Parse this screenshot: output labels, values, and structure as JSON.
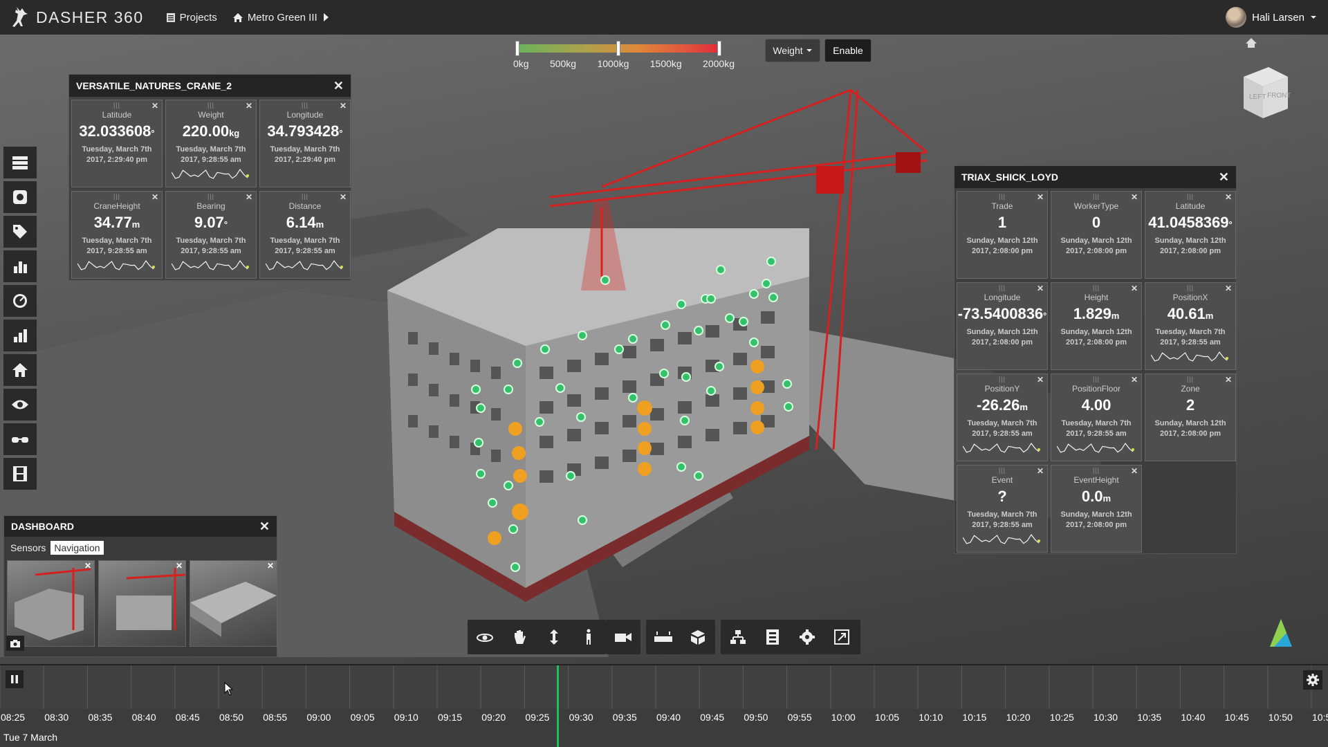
{
  "app": {
    "title": "DASHER 360"
  },
  "breadcrumb": {
    "projects": "Projects",
    "project": "Metro Green III"
  },
  "user": {
    "name": "Hali Larsen"
  },
  "scale": {
    "labels": [
      "0kg",
      "500kg",
      "1000kg",
      "1500kg",
      "2000kg"
    ],
    "weight_button": "Weight",
    "enable_button": "Enable"
  },
  "crane_panel": {
    "title": "VERSATILE_NATURES_CRANE_2",
    "tiles": [
      {
        "label": "Latitude",
        "value": "32.033608",
        "unit": "°",
        "date": "Tuesday, March 7th 2017, 2:29:40 pm",
        "spark": false
      },
      {
        "label": "Weight",
        "value": "220.00",
        "unit": "kg",
        "date": "Tuesday, March 7th 2017, 9:28:55 am",
        "spark": true
      },
      {
        "label": "Longitude",
        "value": "34.793428",
        "unit": "°",
        "date": "Tuesday, March 7th 2017, 2:29:40 pm",
        "spark": false
      },
      {
        "label": "CraneHeight",
        "value": "34.77",
        "unit": "m",
        "date": "Tuesday, March 7th 2017, 9:28:55 am",
        "spark": true
      },
      {
        "label": "Bearing",
        "value": "9.07",
        "unit": "°",
        "date": "Tuesday, March 7th 2017, 9:28:55 am",
        "spark": true
      },
      {
        "label": "Distance",
        "value": "6.14",
        "unit": "m",
        "date": "Tuesday, March 7th 2017, 9:28:55 am",
        "spark": true
      }
    ]
  },
  "worker_panel": {
    "title": "TRIAX_SHICK_LOYD",
    "tiles": [
      {
        "label": "Trade",
        "value": "1",
        "unit": "",
        "date": "Sunday, March 12th 2017, 2:08:00 pm",
        "spark": false
      },
      {
        "label": "WorkerType",
        "value": "0",
        "unit": "",
        "date": "Sunday, March 12th 2017, 2:08:00 pm",
        "spark": false
      },
      {
        "label": "Latitude",
        "value": "41.0458369",
        "unit": "°",
        "date": "Sunday, March 12th 2017, 2:08:00 pm",
        "spark": false
      },
      {
        "label": "Longitude",
        "value": "-73.5400836",
        "unit": "°",
        "date": "Sunday, March 12th 2017, 2:08:00 pm",
        "spark": false
      },
      {
        "label": "Height",
        "value": "1.829",
        "unit": "m",
        "date": "Sunday, March 12th 2017, 2:08:00 pm",
        "spark": false
      },
      {
        "label": "PositionX",
        "value": "40.61",
        "unit": "m",
        "date": "Tuesday, March 7th 2017, 9:28:55 am",
        "spark": true
      },
      {
        "label": "PositionY",
        "value": "-26.26",
        "unit": "m",
        "date": "Tuesday, March 7th 2017, 9:28:55 am",
        "spark": true
      },
      {
        "label": "PositionFloor",
        "value": "4.00",
        "unit": "",
        "date": "Tuesday, March 7th 2017, 9:28:55 am",
        "spark": true
      },
      {
        "label": "Zone",
        "value": "2",
        "unit": "",
        "date": "Sunday, March 12th 2017, 2:08:00 pm",
        "spark": false
      },
      {
        "label": "Event",
        "value": "?",
        "unit": "",
        "date": "Tuesday, March 7th 2017, 9:28:55 am",
        "spark": true
      },
      {
        "label": "EventHeight",
        "value": "0.0",
        "unit": "m",
        "date": "Sunday, March 12th 2017, 2:08:00 pm",
        "spark": false
      }
    ]
  },
  "dashboard": {
    "title": "DASHBOARD",
    "tabs": [
      "Sensors",
      "Navigation"
    ],
    "active_tab": "Navigation"
  },
  "viewcube": {
    "left": "LEFT",
    "front": "FRONT"
  },
  "left_toolbar": [
    "list-icon",
    "sensor-icon",
    "tag-icon",
    "bar-chart-icon",
    "gauge-icon",
    "stacked-chart-icon",
    "home-icon",
    "eye-icon",
    "glasses-icon",
    "film-icon"
  ],
  "nav_toolbar": [
    "orbit-icon",
    "pan-icon",
    "zoom-icon",
    "walk-icon",
    "camera-icon",
    "measure-icon",
    "explode-icon",
    "model-tree-icon",
    "properties-icon",
    "settings-icon",
    "fullscreen-icon"
  ],
  "timeline": {
    "labels": [
      "08:25",
      "08:30",
      "08:35",
      "08:40",
      "08:45",
      "08:50",
      "08:55",
      "09:00",
      "09:05",
      "09:10",
      "09:15",
      "09:20",
      "09:25",
      "09:30",
      "09:35",
      "09:40",
      "09:45",
      "09:50",
      "09:55",
      "10:00",
      "10:05",
      "10:10",
      "10:15",
      "10:20",
      "10:25",
      "10:30",
      "10:35",
      "10:40",
      "10:45",
      "10:50",
      "10:5"
    ],
    "date": "Tue 7 March"
  }
}
